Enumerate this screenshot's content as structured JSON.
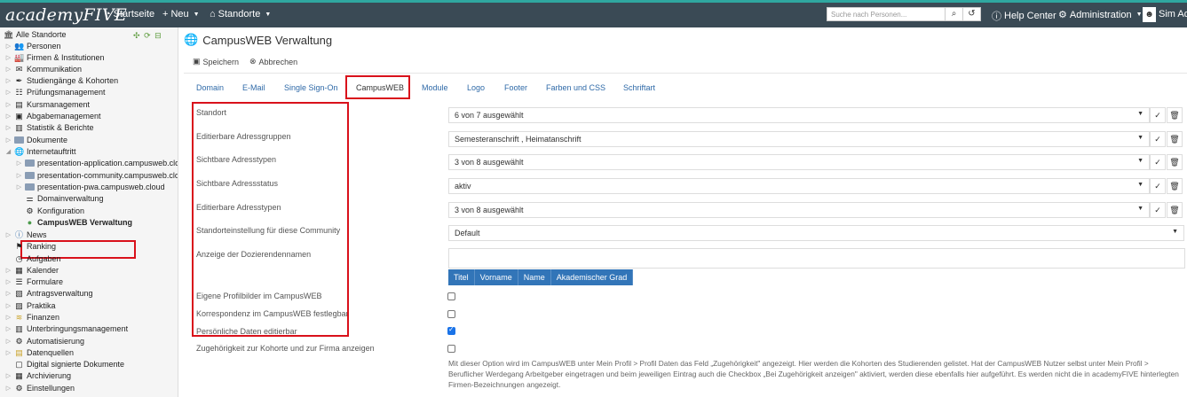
{
  "topbar": {
    "logo": "academyFIVE",
    "home": "Startseite",
    "new": "Neu",
    "locations": "Standorte",
    "search_placeholder": "Suche nach Personen...",
    "help": "Help Center",
    "admin": "Administration",
    "user": "Sim Adr"
  },
  "sidebar": {
    "root": "Alle Standorte",
    "items": [
      "Personen",
      "Firmen & Institutionen",
      "Kommunikation",
      "Studiengänge & Kohorten",
      "Prüfungsmanagement",
      "Kursmanagement",
      "Abgabemanagement",
      "Statistik & Berichte",
      "Dokumente",
      "Internetauftritt",
      "presentation-application.campusweb.cloud",
      "presentation-community.campusweb.cloud",
      "presentation-pwa.campusweb.cloud",
      "Domainverwaltung",
      "Konfiguration",
      "CampusWEB Verwaltung",
      "News",
      "Ranking",
      "Aufgaben",
      "Kalender",
      "Formulare",
      "Antragsverwaltung",
      "Praktika",
      "Finanzen",
      "Unterbringungsmanagement",
      "Automatisierung",
      "Datenquellen",
      "Digital signierte Dokumente",
      "Archivierung",
      "Einstellungen"
    ]
  },
  "page": {
    "title": "CampusWEB Verwaltung",
    "save": "Speichern",
    "cancel": "Abbrechen"
  },
  "tabs": [
    "Domain",
    "E-Mail",
    "Single Sign-On",
    "CampusWEB",
    "Module",
    "Logo",
    "Footer",
    "Farben und CSS",
    "Schriftart"
  ],
  "form": {
    "labels": [
      "Standort",
      "Editierbare Adressgruppen",
      "Sichtbare Adresstypen",
      "Sichtbare Adressstatus",
      "Editierbare Adresstypen",
      "Standorteinstellung für diese Community",
      "Anzeige der Dozierendennamen",
      "Eigene Profilbilder im CampusWEB",
      "Korrespondenz im CampusWEB festlegbar",
      "Persönliche Daten editierbar",
      "Zugehörigkeit zur Kohorte und zur Firma anzeigen"
    ],
    "values": [
      "6 von 7 ausgewählt",
      "Semesteranschrift , Heimatanschrift",
      "3 von 8 ausgewählt",
      "aktiv",
      "3 von 8 ausgewählt",
      "Default"
    ],
    "name_chips": [
      "Titel",
      "Vorname",
      "Name",
      "Akademischer Grad"
    ],
    "checkboxes": [
      false,
      false,
      true,
      false
    ],
    "help_text": "Mit dieser Option wird im CampusWEB unter Mein Profil > Profil Daten das Feld „Zugehörigkeit\" angezeigt. Hier werden die Kohorten des Studierenden gelistet. Hat der CampusWEB Nutzer selbst unter Mein Profil > Beruflicher Werdegang Arbeitgeber eingetragen und beim jeweiligen Eintrag auch die Checkbox „Bei Zugehörigkeit anzeigen\" aktiviert, werden diese ebenfalls hier aufgeführt. Es werden nicht die in academyFIVE hinterlegten Firmen-Bezeichnungen angezeigt."
  },
  "colors": {
    "topbar": "#3a4a55",
    "accent": "#2fa7a0",
    "link": "#2f6aa8",
    "chip": "#3275b8",
    "highlight": "#d9111b"
  }
}
